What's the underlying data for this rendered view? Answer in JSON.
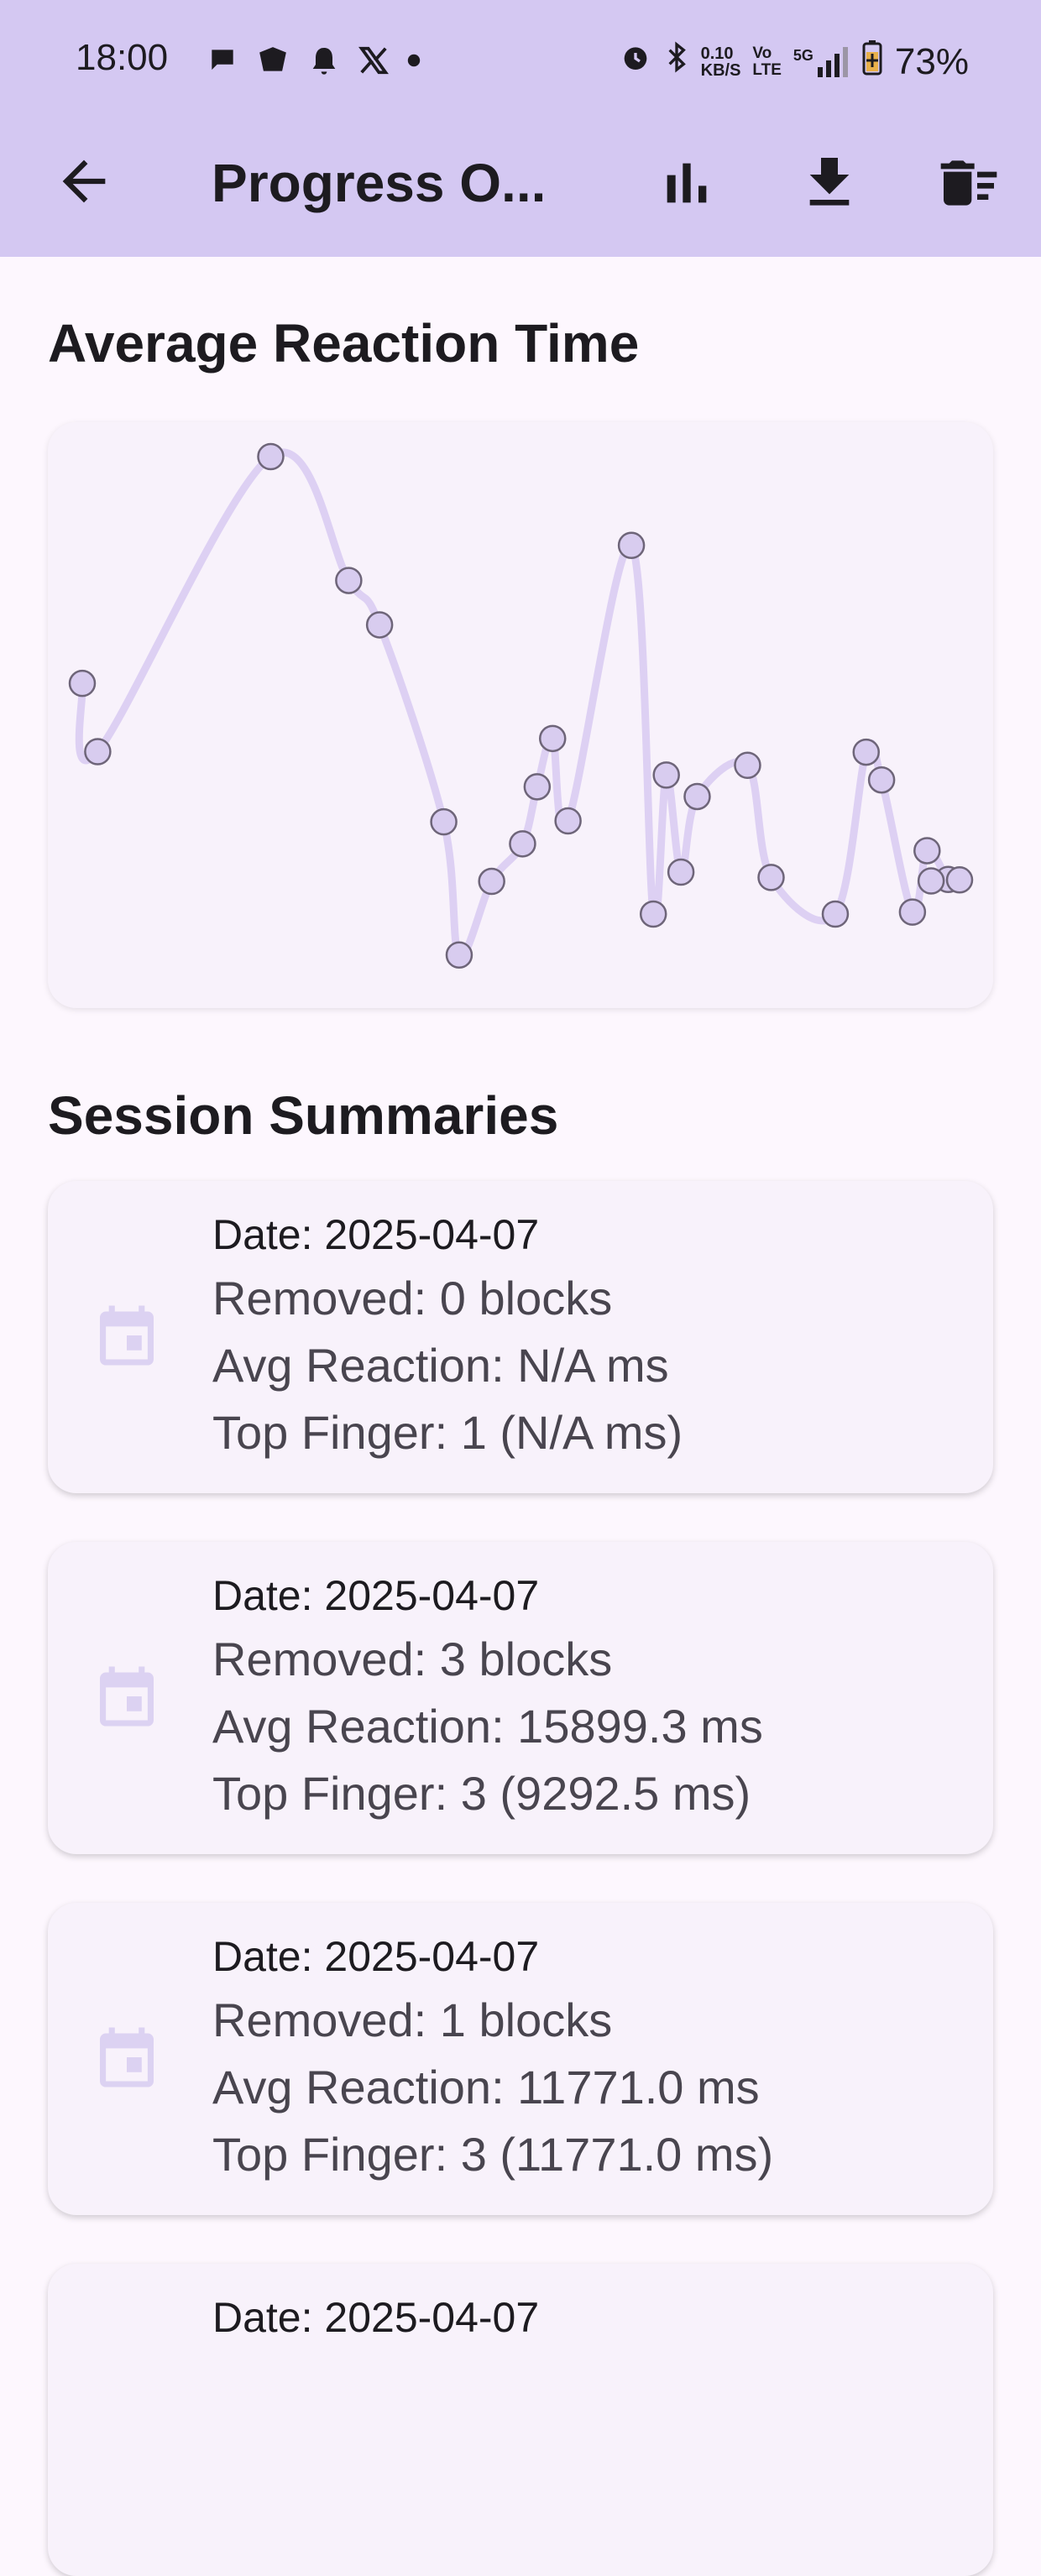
{
  "status_bar": {
    "time": "18:00",
    "net_speed_top": "0.10",
    "net_speed_bottom": "KB/S",
    "volte_top": "Vo",
    "volte_bottom": "LTE",
    "network": "5G",
    "battery": "73%"
  },
  "app_bar": {
    "title": "Progress O..."
  },
  "sections": {
    "chart_title": "Average Reaction Time",
    "sessions_title": "Session Summaries"
  },
  "chart_data": {
    "type": "line",
    "title": "Average Reaction Time",
    "xlabel": "",
    "ylabel": "",
    "y_range_relative": [
      0,
      1
    ],
    "grid": false,
    "legend": "none",
    "series": [
      {
        "values": [
          0.535,
          0.395,
          1.0,
          0.746,
          0.655,
          0.251,
          -0.022,
          0.129,
          0.206,
          0.323,
          0.422,
          0.253,
          0.818,
          0.062,
          0.347,
          0.148,
          0.303,
          0.367,
          0.137,
          0.062,
          0.394,
          0.337,
          0.066,
          0.192,
          0.133,
          0.132,
          0.13
        ]
      }
    ],
    "line_color": "#ddd0f3",
    "point_fill": "#d8ccef",
    "point_stroke": "#6e6579"
  },
  "sessions": [
    {
      "date": "Date: 2025-04-07",
      "removed": "Removed: 0 blocks",
      "avg": "Avg Reaction: N/A ms",
      "top": "Top Finger: 1 (N/A ms)"
    },
    {
      "date": "Date: 2025-04-07",
      "removed": "Removed: 3 blocks",
      "avg": "Avg Reaction: 15899.3 ms",
      "top": "Top Finger: 3 (9292.5 ms)"
    },
    {
      "date": "Date: 2025-04-07",
      "removed": "Removed: 1 blocks",
      "avg": "Avg Reaction: 11771.0 ms",
      "top": "Top Finger: 3 (11771.0 ms)"
    },
    {
      "date": "Date: 2025-04-07"
    }
  ],
  "colors": {
    "app_bar": "#d4c8f2",
    "background": "#fdf7fe",
    "card": "#f8f2fb",
    "accent": "#d8ccef"
  },
  "icons": {
    "back": "arrow-left-icon",
    "chart": "bar-chart-icon",
    "download": "download-icon",
    "delete": "delete-sweep-icon",
    "calendar": "calendar-icon"
  }
}
